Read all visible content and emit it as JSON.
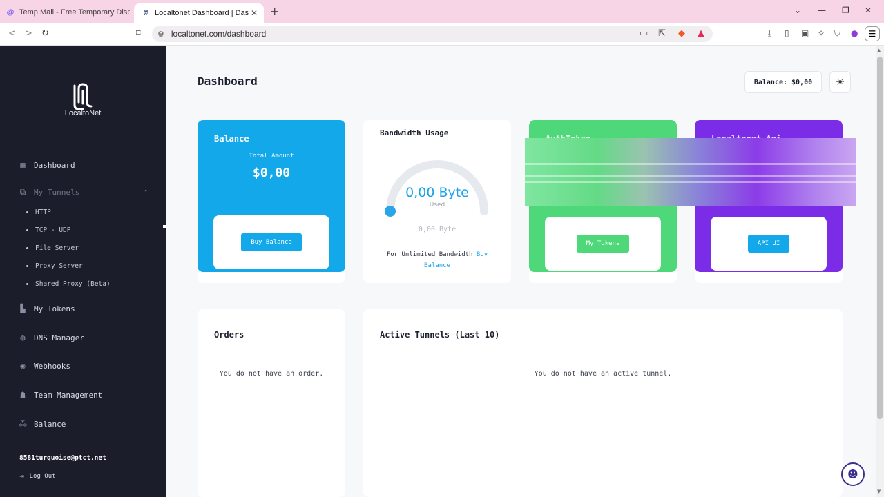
{
  "browser": {
    "tabs": [
      {
        "title": "Temp Mail - Free Temporary Dispos",
        "favicon": "at-icon"
      },
      {
        "title": "Localtonet Dashboard | Dashbo",
        "favicon": "localtonet-icon"
      }
    ],
    "url": "localtonet.com/dashboard",
    "new_tab": "+",
    "tab_close": "✕"
  },
  "sidebar": {
    "logo_text": "LocaltoNet",
    "items": [
      {
        "label": "Dashboard",
        "icon": "layout-icon"
      },
      {
        "label": "My Tunnels",
        "icon": "tunnel-icon"
      },
      {
        "label": "My Tokens",
        "icon": "token-icon"
      },
      {
        "label": "DNS Manager",
        "icon": "globe-icon"
      },
      {
        "label": "Webhooks",
        "icon": "webhook-icon"
      },
      {
        "label": "Team Management",
        "icon": "team-icon"
      },
      {
        "label": "Balance",
        "icon": "balance-icon"
      }
    ],
    "tunnel_sub": [
      "HTTP",
      "TCP - UDP",
      "File Server",
      "Proxy Server",
      "Shared Proxy (Beta)"
    ],
    "email": "8581turquoise@ptct.net",
    "logout": "Log Out"
  },
  "main": {
    "title": "Dashboard",
    "balance_pill": "Balance: $0,00",
    "cards": {
      "balance": {
        "title": "Balance",
        "subtitle": "Total Amount",
        "value": "$0,00",
        "button": "Buy Balance",
        "color": "#13a8ea"
      },
      "bandwidth": {
        "title": "Bandwidth Usage",
        "value": "0,00 Byte",
        "used": "Used",
        "total": "0,00 Byte",
        "note": "For Unlimited Bandwidth",
        "link": "Buy Balance",
        "usage_fraction": 0
      },
      "authtoken": {
        "title": "AuthToken",
        "button": "My Tokens",
        "color": "#4ed879"
      },
      "api": {
        "title": "Localtonet Api",
        "button": "API UI",
        "color": "#7a2ce6"
      }
    },
    "orders": {
      "title": "Orders",
      "empty": "You do not have an order."
    },
    "active_tunnels": {
      "title": "Active Tunnels (Last 10)",
      "empty": "You do not have an active tunnel."
    }
  }
}
